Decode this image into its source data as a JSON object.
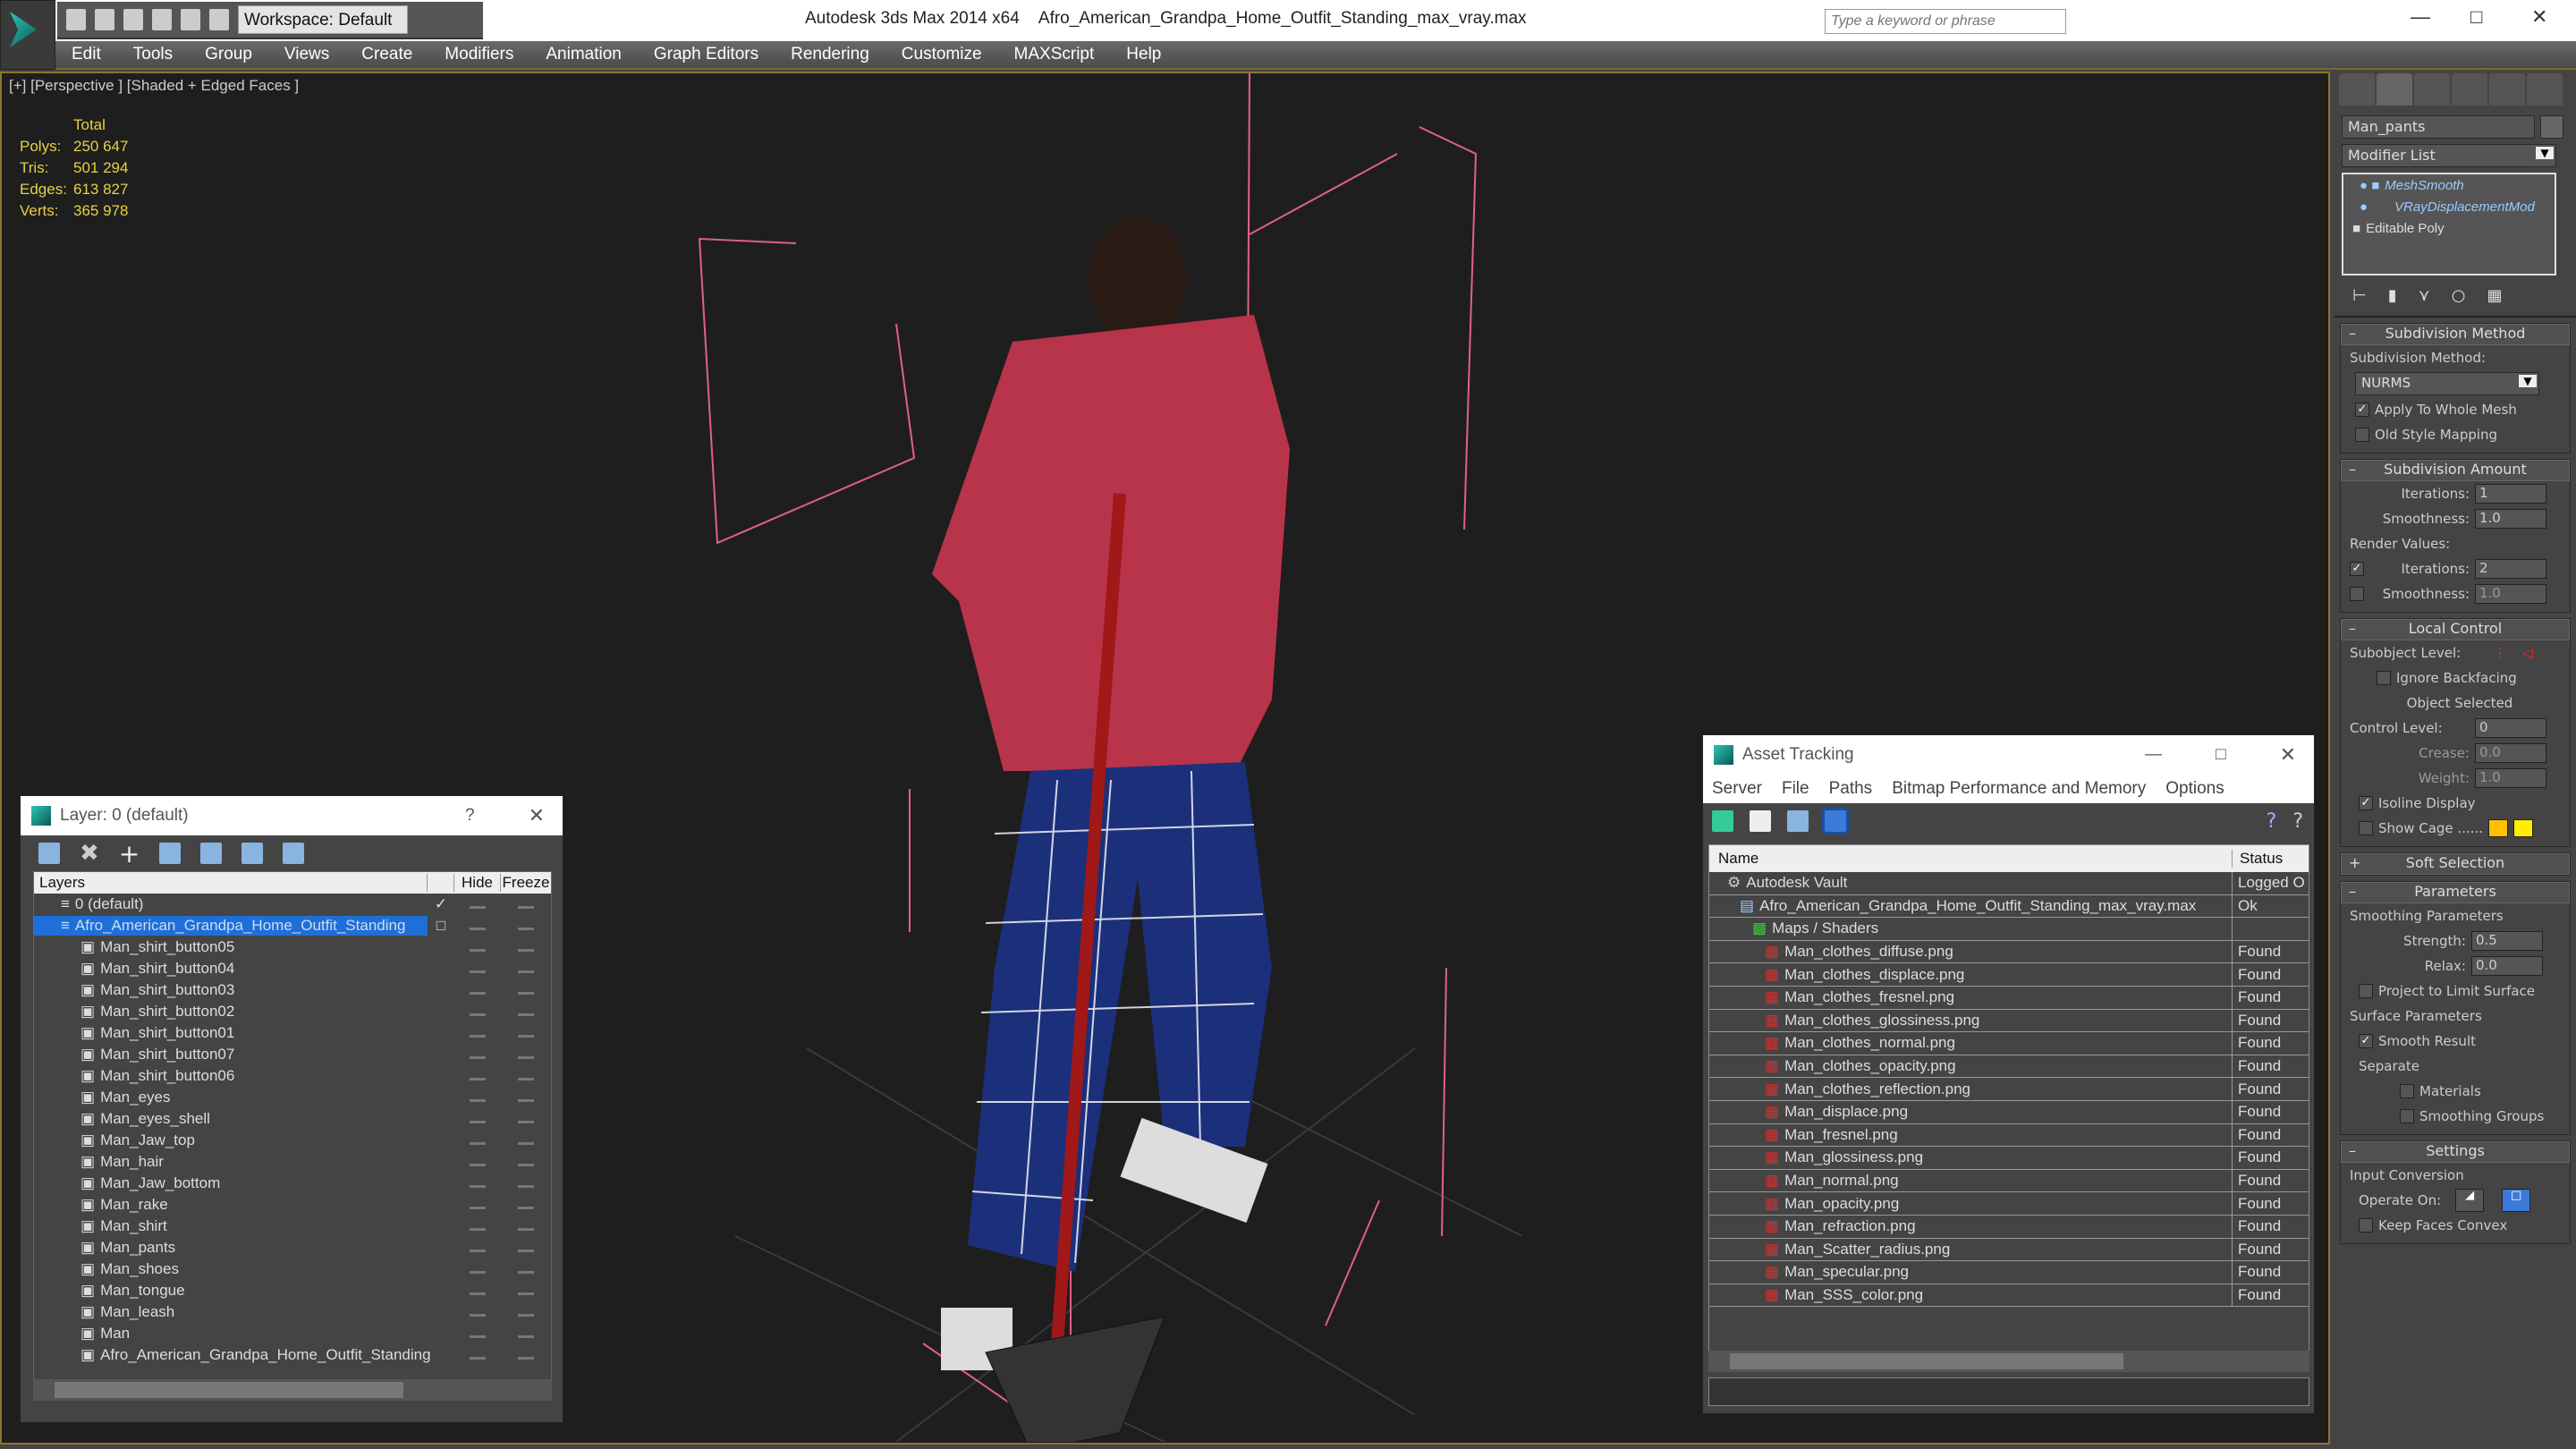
{
  "titlebar": {
    "workspace": "Workspace: Default",
    "app": "Autodesk 3ds Max  2014 x64",
    "file": "Afro_American_Grandpa_Home_Outfit_Standing_max_vray.max",
    "search_placeholder": "Type a keyword or phrase"
  },
  "menu": [
    "Edit",
    "Tools",
    "Group",
    "Views",
    "Create",
    "Modifiers",
    "Animation",
    "Graph Editors",
    "Rendering",
    "Customize",
    "MAXScript",
    "Help"
  ],
  "viewport": {
    "label": "[+] [Perspective ] [Shaded + Edged Faces ]",
    "stats": {
      "title": "Total",
      "rows": [
        [
          "Polys:",
          "250 647"
        ],
        [
          "Tris:",
          "501 294"
        ],
        [
          "Edges:",
          "613 827"
        ],
        [
          "Verts:",
          "365 978"
        ]
      ]
    }
  },
  "layer_dialog": {
    "title": "Layer: 0 (default)",
    "help": "?",
    "columns": [
      "Layers",
      "Hide",
      "Freeze"
    ],
    "rows": [
      "0 (default)",
      "Afro_American_Grandpa_Home_Outfit_Standing",
      "Man_shirt_button05",
      "Man_shirt_button04",
      "Man_shirt_button03",
      "Man_shirt_button02",
      "Man_shirt_button01",
      "Man_shirt_button07",
      "Man_shirt_button06",
      "Man_eyes",
      "Man_eyes_shell",
      "Man_Jaw_top",
      "Man_hair",
      "Man_Jaw_bottom",
      "Man_rake",
      "Man_shirt",
      "Man_pants",
      "Man_shoes",
      "Man_tongue",
      "Man_leash",
      "Man",
      "Afro_American_Grandpa_Home_Outfit_Standing"
    ],
    "selected_index": 1,
    "selection_color": "#1e6fd9"
  },
  "asset_tracking": {
    "title": "Asset Tracking",
    "menu": [
      "Server",
      "File",
      "Paths",
      "Bitmap Performance and Memory",
      "Options"
    ],
    "columns": [
      "Name",
      "Status"
    ],
    "rows": [
      {
        "name": "Autodesk Vault",
        "status": "Logged O",
        "level": 0
      },
      {
        "name": "Afro_American_Grandpa_Home_Outfit_Standing_max_vray.max",
        "status": "Ok",
        "level": 1
      },
      {
        "name": "Maps / Shaders",
        "status": "",
        "level": 2
      },
      {
        "name": "Man_clothes_diffuse.png",
        "status": "Found",
        "level": 3
      },
      {
        "name": "Man_clothes_displace.png",
        "status": "Found",
        "level": 3
      },
      {
        "name": "Man_clothes_fresnel.png",
        "status": "Found",
        "level": 3
      },
      {
        "name": "Man_clothes_glossiness.png",
        "status": "Found",
        "level": 3
      },
      {
        "name": "Man_clothes_normal.png",
        "status": "Found",
        "level": 3
      },
      {
        "name": "Man_clothes_opacity.png",
        "status": "Found",
        "level": 3
      },
      {
        "name": "Man_clothes_reflection.png",
        "status": "Found",
        "level": 3
      },
      {
        "name": "Man_displace.png",
        "status": "Found",
        "level": 3
      },
      {
        "name": "Man_fresnel.png",
        "status": "Found",
        "level": 3
      },
      {
        "name": "Man_glossiness.png",
        "status": "Found",
        "level": 3
      },
      {
        "name": "Man_normal.png",
        "status": "Found",
        "level": 3
      },
      {
        "name": "Man_opacity.png",
        "status": "Found",
        "level": 3
      },
      {
        "name": "Man_refraction.png",
        "status": "Found",
        "level": 3
      },
      {
        "name": "Man_Scatter_radius.png",
        "status": "Found",
        "level": 3
      },
      {
        "name": "Man_specular.png",
        "status": "Found",
        "level": 3
      },
      {
        "name": "Man_SSS_color.png",
        "status": "Found",
        "level": 3
      }
    ]
  },
  "command_panel": {
    "object_name": "Man_pants",
    "modifier_list": "Modifier List",
    "stack": [
      "MeshSmooth",
      "VRayDisplacementMod",
      "Editable Poly"
    ],
    "subdivision_method": {
      "title": "Subdivision Method",
      "label": "Subdivision Method:",
      "value": "NURMS",
      "apply_whole": "Apply To Whole Mesh",
      "apply_whole_checked": true,
      "old_style": "Old Style Mapping",
      "old_style_checked": false
    },
    "subdivision_amount": {
      "title": "Subdivision Amount",
      "iterations_label": "Iterations:",
      "iterations": "1",
      "smoothness_label": "Smoothness:",
      "smoothness": "1.0",
      "render_values": "Render Values:",
      "r_iterations": "2",
      "r_iterations_checked": true,
      "r_smoothness": "1.0",
      "r_smoothness_checked": false
    },
    "local_control": {
      "title": "Local Control",
      "subobject": "Subobject Level:",
      "ignore_backfacing": "Ignore Backfacing",
      "object_selected": "Object Selected",
      "control_level_label": "Control Level:",
      "control_level": "0",
      "crease_label": "Crease:",
      "crease": "0.0",
      "weight_label": "Weight:",
      "weight": "1.0",
      "isoline": "Isoline Display",
      "isoline_checked": true,
      "show_cage": "Show Cage ......",
      "cage_colors": [
        "#ffc000",
        "#ffee00"
      ]
    },
    "soft_selection": {
      "title": "Soft Selection"
    },
    "parameters": {
      "title": "Parameters",
      "smoothing": "Smoothing Parameters",
      "strength_label": "Strength:",
      "strength": "0.5",
      "relax_label": "Relax:",
      "relax": "0.0",
      "project": "Project to Limit Surface",
      "surface": "Surface Parameters",
      "smooth_result": "Smooth Result",
      "separate": "Separate",
      "materials": "Materials",
      "smoothing_groups": "Smoothing Groups"
    },
    "settings": {
      "title": "Settings",
      "input_conversion": "Input Conversion",
      "operate_on": "Operate On:",
      "keep_convex": "Keep Faces Convex"
    }
  }
}
